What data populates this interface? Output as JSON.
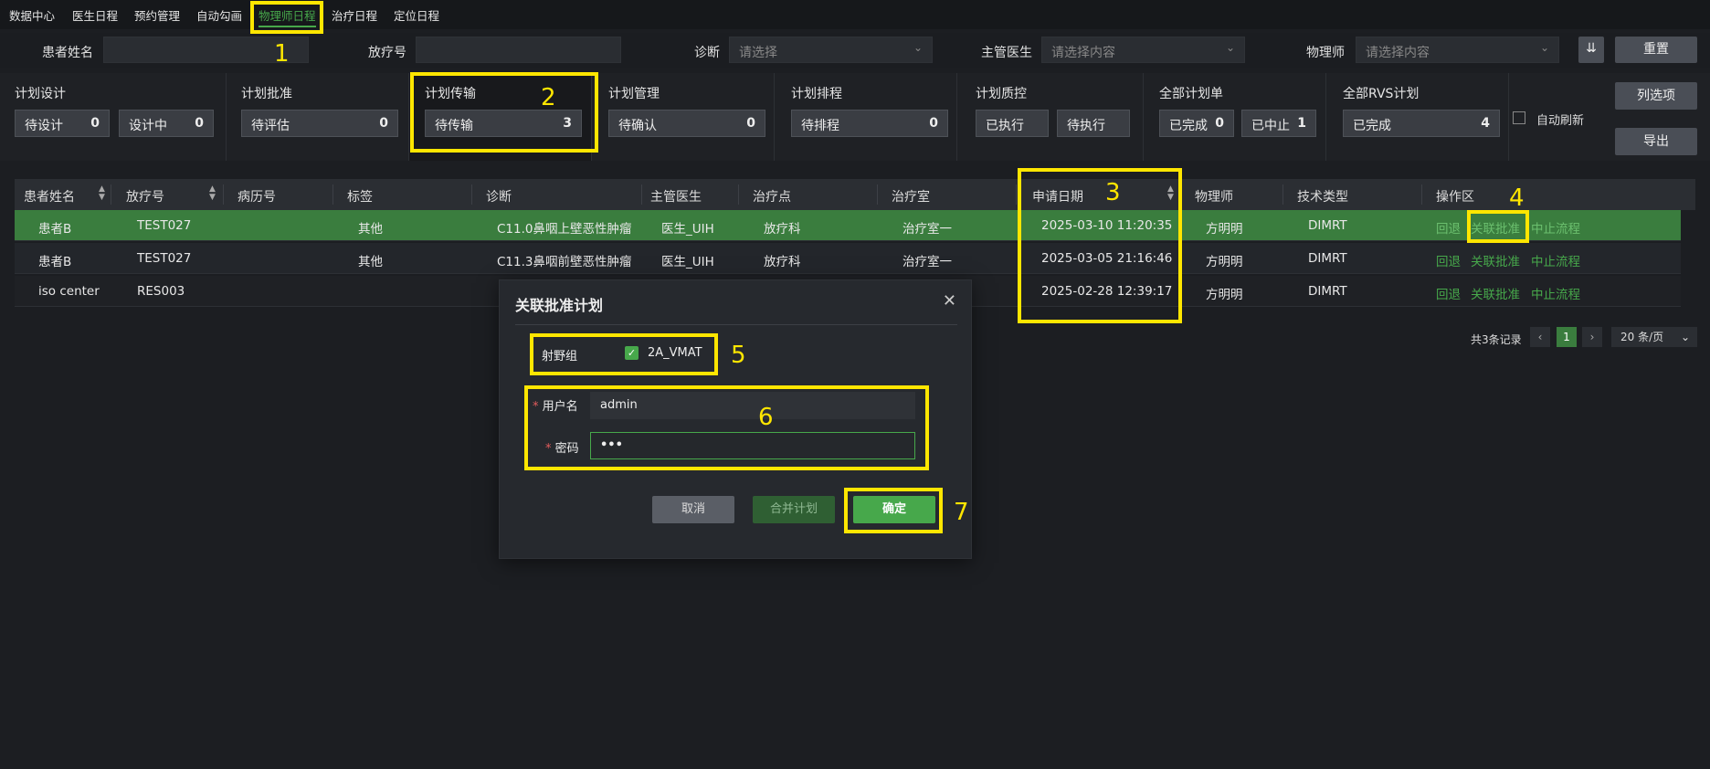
{
  "nav": [
    {
      "label": "数据中心"
    },
    {
      "label": "医生日程"
    },
    {
      "label": "预约管理"
    },
    {
      "label": "自动勾画"
    },
    {
      "label": "物理师日程",
      "active": true
    },
    {
      "label": "治疗日程"
    },
    {
      "label": "定位日程"
    }
  ],
  "filters": {
    "patient_name_label": "患者姓名",
    "patient_name_value": "",
    "treatment_no_label": "放疗号",
    "treatment_no_value": "",
    "diagnosis_label": "诊断",
    "diagnosis_placeholder": "请选择",
    "doctor_label": "主管医生",
    "doctor_placeholder": "请选择内容",
    "physicist_label": "物理师",
    "physicist_placeholder": "请选择内容",
    "expand_icon": "double-chevron-down",
    "reset_label": "重置"
  },
  "stats": {
    "groups": [
      {
        "title": "计划设计",
        "boxes": [
          {
            "label": "待设计",
            "count": "0"
          },
          {
            "label": "设计中",
            "count": "0"
          }
        ]
      },
      {
        "title": "计划批准",
        "boxes": [
          {
            "label": "待评估",
            "count": "0"
          }
        ]
      },
      {
        "title": "计划传输",
        "boxes": [
          {
            "label": "待传输",
            "count": "3"
          }
        ]
      },
      {
        "title": "计划管理",
        "boxes": [
          {
            "label": "待确认",
            "count": "0"
          }
        ]
      },
      {
        "title": "计划排程",
        "boxes": [
          {
            "label": "待排程",
            "count": "0"
          }
        ]
      },
      {
        "title": "计划质控",
        "boxes": [
          {
            "label": "已执行",
            "count": ""
          },
          {
            "label": "待执行",
            "count": ""
          }
        ]
      },
      {
        "title": "全部计划单",
        "boxes": [
          {
            "label": "已完成",
            "count": "0"
          },
          {
            "label": "已中止",
            "count": "1"
          }
        ]
      },
      {
        "title": "全部RVS计划",
        "boxes": [
          {
            "label": "已完成",
            "count": "4"
          }
        ]
      }
    ],
    "auto_refresh_label": "自动刷新",
    "column_options_label": "列选项",
    "export_label": "导出"
  },
  "table": {
    "headers": [
      "患者姓名",
      "放疗号",
      "病历号",
      "标签",
      "诊断",
      "主管医生",
      "治疗点",
      "治疗室",
      "申请日期",
      "物理师",
      "技术类型",
      "操作区"
    ],
    "rows": [
      {
        "name": "患者B",
        "rt_no": "TEST027",
        "mr_no": "",
        "tag": "其他",
        "diagnosis": "C11.0鼻咽上壁恶性肿瘤",
        "doctor": "医生_UIH",
        "site": "放疗科",
        "room": "治疗室一",
        "date": "2025-03-10 11:20:35",
        "physicist": "方明明",
        "tech": "DIMRT",
        "selected": true
      },
      {
        "name": "患者B",
        "rt_no": "TEST027",
        "mr_no": "",
        "tag": "其他",
        "diagnosis": "C11.3鼻咽前壁恶性肿瘤",
        "doctor": "医生_UIH",
        "site": "放疗科",
        "room": "治疗室一",
        "date": "2025-03-05 21:16:46",
        "physicist": "方明明",
        "tech": "DIMRT"
      },
      {
        "name": "iso center",
        "rt_no": "RES003",
        "mr_no": "",
        "tag": "",
        "diagnosis": "",
        "doctor": "",
        "site": "",
        "room": "",
        "date": "2025-02-28 12:39:17",
        "physicist": "方明明",
        "tech": "DIMRT"
      }
    ],
    "ops": {
      "back": "回退",
      "link": "关联批准",
      "stop": "中止流程"
    }
  },
  "pagination": {
    "total": "共3条记录",
    "current_page": "1",
    "page_size": "20 条/页"
  },
  "modal": {
    "title": "关联批准计划",
    "field_group_label": "射野组",
    "field_group_option": "2A_VMAT",
    "field_group_checked": true,
    "username_label": "用户名",
    "username_value": "admin",
    "password_label": "密码",
    "password_value": "•••",
    "cancel_label": "取消",
    "merge_label": "合并计划",
    "confirm_label": "确定"
  },
  "annotations": [
    "1",
    "2",
    "3",
    "4",
    "5",
    "6",
    "7"
  ],
  "colors": {
    "accent": "#47a84b",
    "highlight": "#ffe600",
    "background": "#1c1e22"
  }
}
